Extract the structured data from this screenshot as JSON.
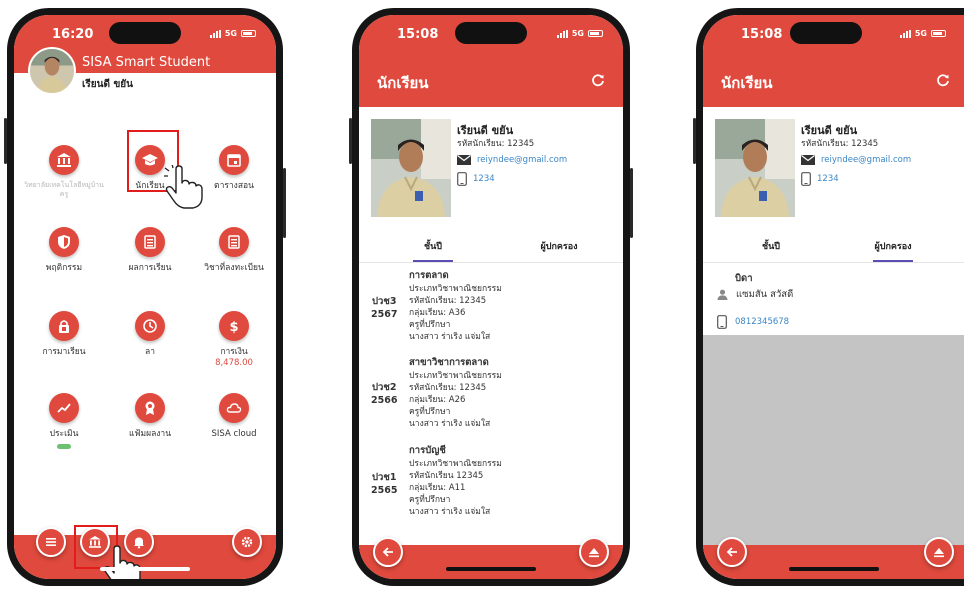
{
  "status_bar": [
    {
      "time": "16:20",
      "network": "5G"
    },
    {
      "time": "15:08",
      "network": "5G"
    },
    {
      "time": "15:08",
      "network": "5G"
    }
  ],
  "home": {
    "app_title": "SISA Smart Student",
    "student_name": "เรียนดี ขยัน",
    "menu": [
      {
        "label": "วิทยาลัยเทคโนโลยีหมู่บ้านครู",
        "icon": "bank-icon",
        "faded": true
      },
      {
        "label": "นักเรียน",
        "icon": "graduation-cap-icon"
      },
      {
        "label": "ตารางสอน",
        "icon": "calendar-icon"
      },
      {
        "label": "พฤติกรรม",
        "icon": "shield-icon"
      },
      {
        "label": "ผลการเรียน",
        "icon": "list-icon"
      },
      {
        "label": "วิชาที่ลงทะเบียน",
        "icon": "list-icon"
      },
      {
        "label": "การมาเรียน",
        "icon": "lock-icon"
      },
      {
        "label": "ลา",
        "icon": "clock-icon"
      },
      {
        "label": "การเงิน",
        "icon": "dollar-icon",
        "sub": "8,478.00"
      },
      {
        "label": "ประเมิน",
        "icon": "trend-icon",
        "pill": true
      },
      {
        "label": "แฟ้มผลงาน",
        "icon": "award-icon"
      },
      {
        "label": "SISA cloud",
        "icon": "cloud-icon"
      }
    ]
  },
  "student": {
    "page_title": "นักเรียน",
    "name": "เรียนดี ขยัน",
    "student_id_line": "รหัสนักเรียน: 12345",
    "email": "reiyndee@gmail.com",
    "phone": "1234",
    "tab_class": "ชั้นปี",
    "tab_guardian": "ผู้ปกครอง",
    "records": [
      {
        "level": "ปวช3",
        "year": "2567",
        "title": "การตลาด",
        "type": "ประเภทวิชาพาณิชยกรรม",
        "sid": "รหัสนักเรียน: 12345",
        "group": "กลุ่มเรียน: A36",
        "advisor_label": "ครูที่ปรึกษา",
        "advisor": "นางสาว ร่าเริง แจ่มใส"
      },
      {
        "level": "ปวช2",
        "year": "2566",
        "title": "สาขาวิชาการตลาด",
        "type": "ประเภทวิชาพาณิชยกรรม",
        "sid": "รหัสนักเรียน: 12345",
        "group": "กลุ่มเรียน: A26",
        "advisor_label": "ครูที่ปรึกษา",
        "advisor": "นางสาว ร่าเริง แจ่มใส"
      },
      {
        "level": "ปวช1",
        "year": "2565",
        "title": "การบัญชี",
        "type": "ประเภทวิชาพาณิชยกรรม",
        "sid": "รหัสนักเรียน 12345",
        "group": "กลุ่มเรียน: A11",
        "advisor_label": "ครูที่ปรึกษา",
        "advisor": "นางสาว ร่าเริง แจ่มใส"
      }
    ]
  },
  "guardian": {
    "relation": "บิดา",
    "name": "แซมสัน สวัสดี",
    "phone": "0812345678"
  },
  "colors": {
    "accent": "#e0493d",
    "highlight": "#e21b1b",
    "link": "#3a86c8",
    "tab_indicator": "#5a4fb0"
  }
}
